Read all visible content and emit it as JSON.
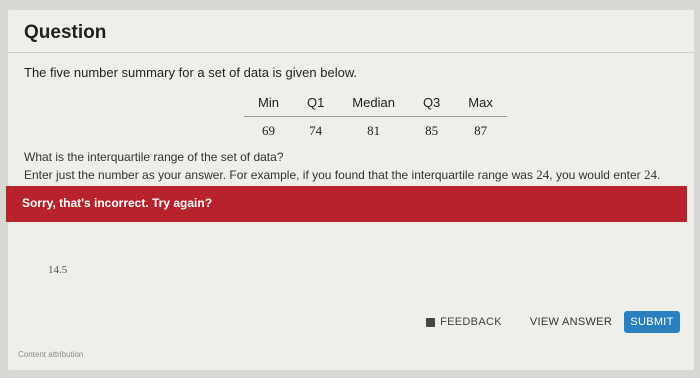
{
  "question": {
    "title": "Question",
    "prompt": "The five number summary for a set of data is given below.",
    "table": {
      "headers": [
        "Min",
        "Q1",
        "Median",
        "Q3",
        "Max"
      ],
      "values": [
        "69",
        "74",
        "81",
        "85",
        "87"
      ]
    },
    "question_line": "What is the interquartile range of the set of data?",
    "instruction_before": "Enter just the number as your answer. For example, if you found that the interquartile range was ",
    "instruction_example_1": "24",
    "instruction_middle": ", you would enter ",
    "instruction_example_2": "24",
    "instruction_end": "."
  },
  "feedback": {
    "message": "Sorry, that's incorrect. Try again?",
    "color": "#b8222d"
  },
  "answer": {
    "value": "14.5"
  },
  "buttons": {
    "feedback": "FEEDBACK",
    "view_answer": "VIEW ANSWER",
    "submit": "SUBMIT",
    "submit_color": "#2a7fbe"
  },
  "footer": {
    "attribution": "Content attribution"
  }
}
